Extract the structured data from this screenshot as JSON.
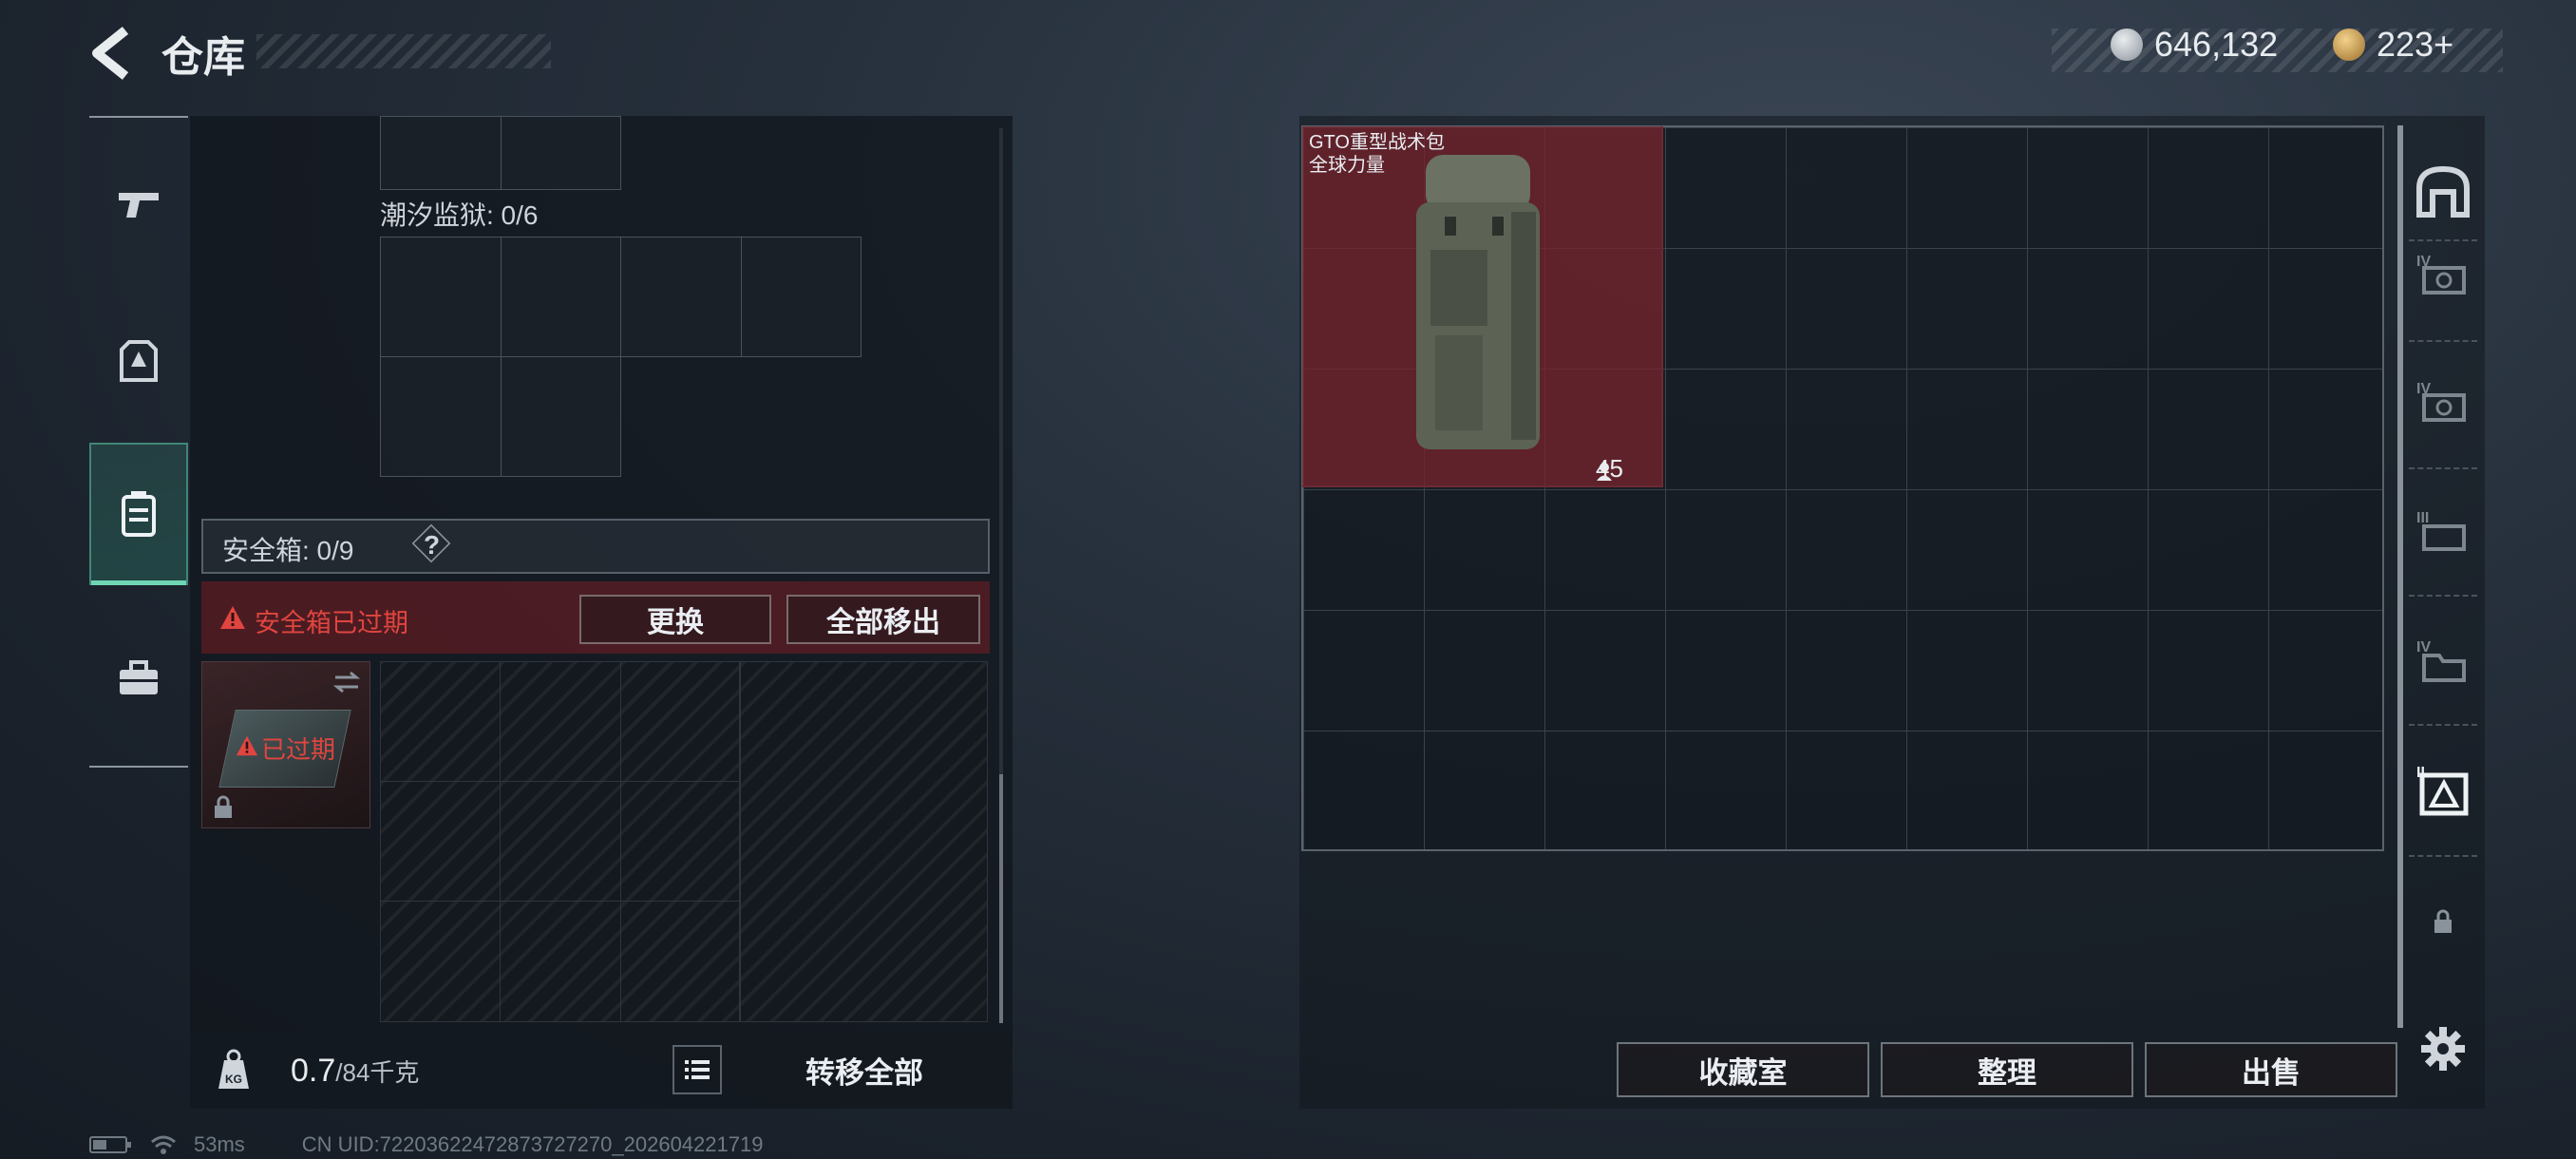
{
  "header": {
    "title": "仓库",
    "currency_silver": "646,132",
    "currency_gold": "223+"
  },
  "left_panel": {
    "prison_label": "潮汐监狱: 0/6",
    "safe_box_label": "安全箱: 0/9",
    "help_label": "?",
    "alert_text": "安全箱已过期",
    "replace_button": "更换",
    "remove_all_button": "全部移出",
    "expired_badge": "已过期",
    "weight_value": "0.7",
    "weight_max": "/84千克",
    "transfer_all_button": "转移全部"
  },
  "stash": {
    "item_name": "GTO重型战术包",
    "item_brand": "全球力量",
    "item_count": "45"
  },
  "bottom_buttons": {
    "collection": "收藏室",
    "organize": "整理",
    "sell": "出售"
  },
  "status": {
    "ping": "53ms",
    "uid": "CN UID:72203622472873727270_202604221719"
  },
  "colors": {
    "accent_teal": "#6fd6b4",
    "alert_red": "#e0453f",
    "item_red": "#782430"
  }
}
